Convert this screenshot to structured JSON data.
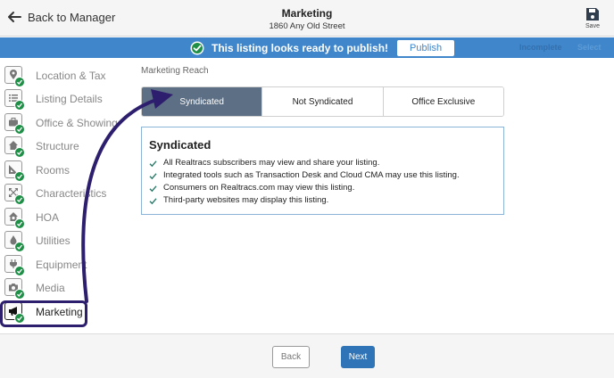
{
  "header": {
    "back_label": "Back to Manager",
    "title": "Marketing",
    "subtitle": "1860 Any Old Street",
    "save_label": "Save"
  },
  "banner": {
    "message": "This listing looks ready to publish!",
    "publish_label": "Publish",
    "incomplete_label": "Incomplete",
    "select_label": "Select",
    "background_color": "#3f86cb"
  },
  "sidebar": {
    "items": [
      {
        "label": "Location & Tax",
        "icon": "map-pin-icon",
        "complete": true
      },
      {
        "label": "Listing Details",
        "icon": "list-icon",
        "complete": true
      },
      {
        "label": "Office & Showing",
        "icon": "briefcase-icon",
        "complete": true
      },
      {
        "label": "Structure",
        "icon": "house-icon",
        "complete": true
      },
      {
        "label": "Rooms",
        "icon": "ruler-icon",
        "complete": true
      },
      {
        "label": "Characteristics",
        "icon": "expand-icon",
        "complete": true
      },
      {
        "label": "HOA",
        "icon": "hoa-house-icon",
        "complete": true
      },
      {
        "label": "Utilities",
        "icon": "drop-icon",
        "complete": true
      },
      {
        "label": "Equipment",
        "icon": "plug-icon",
        "complete": true
      },
      {
        "label": "Media",
        "icon": "camera-icon",
        "complete": true
      },
      {
        "label": "Marketing",
        "icon": "megaphone-icon",
        "complete": true,
        "active": true
      }
    ]
  },
  "main": {
    "section_label": "Marketing Reach",
    "options": [
      "Syndicated",
      "Not Syndicated",
      "Office Exclusive"
    ],
    "selected_option": "Syndicated",
    "info": {
      "title": "Syndicated",
      "items": [
        "All Realtracs subscribers may view and share your listing.",
        "Integrated tools such as Transaction Desk and Cloud CMA may use this listing.",
        "Consumers on Realtracs.com may view this listing.",
        "Third-party websites may display this listing."
      ]
    }
  },
  "footer": {
    "back_label": "Back",
    "next_label": "Next"
  },
  "colors": {
    "primary": "#2f74b7",
    "selected_segment": "#5c6f84",
    "complete_badge": "#1f8f47",
    "annotation": "#2e1f6e"
  }
}
